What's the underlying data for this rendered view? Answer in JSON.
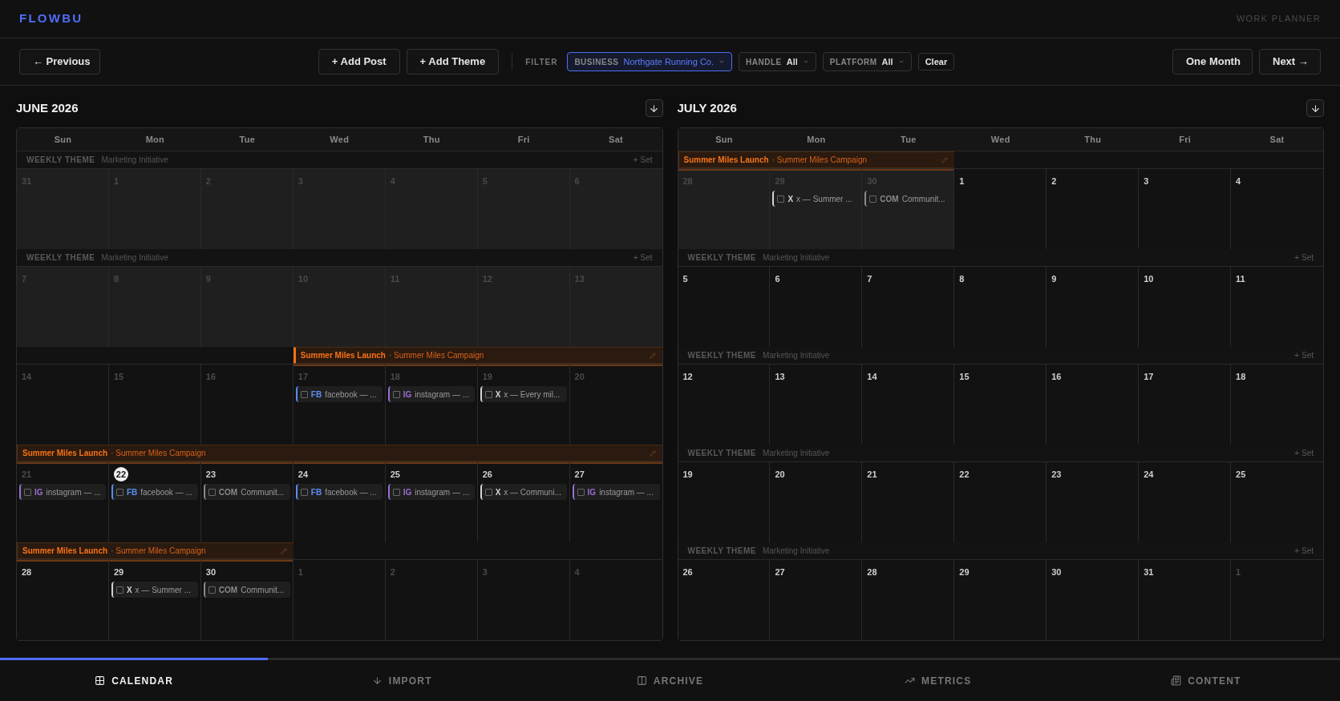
{
  "app": {
    "logo": "FLOWBU",
    "section": "WORK PLANNER"
  },
  "toolbar": {
    "previous": "← Previous",
    "add_post": "+ Add Post",
    "add_theme": "+ Add Theme",
    "filter_label": "FILTER",
    "filters": [
      {
        "label": "BUSINESS",
        "value": "Northgate Running Co.",
        "active": true
      },
      {
        "label": "HANDLE",
        "value": "All",
        "active": false
      },
      {
        "label": "PLATFORM",
        "value": "All",
        "active": false
      }
    ],
    "clear": "Clear",
    "range": "One Month",
    "next": "Next →"
  },
  "months": [
    {
      "title": "JUNE 2026",
      "weekdays": [
        "Sun",
        "Mon",
        "Tue",
        "Wed",
        "Thu",
        "Fri",
        "Sat"
      ],
      "weeks": [
        {
          "theme": {
            "kind": "placeholder",
            "title": "WEEKLY THEME",
            "subtitle": "Marketing Initiative",
            "action": "+ Set"
          },
          "days": [
            {
              "label": "31",
              "muted": true,
              "shaded": true,
              "today": false
            },
            {
              "label": "1",
              "muted": true,
              "shaded": true,
              "today": false
            },
            {
              "label": "2",
              "muted": true,
              "shaded": true,
              "today": false
            },
            {
              "label": "3",
              "muted": true,
              "shaded": true,
              "today": false
            },
            {
              "label": "4",
              "muted": true,
              "shaded": true,
              "today": false
            },
            {
              "label": "5",
              "muted": true,
              "shaded": true,
              "today": false
            },
            {
              "label": "6",
              "muted": true,
              "shaded": true,
              "today": false
            }
          ]
        },
        {
          "theme": {
            "kind": "placeholder",
            "title": "WEEKLY THEME",
            "subtitle": "Marketing Initiative",
            "action": "+ Set"
          },
          "days": [
            {
              "label": "7",
              "muted": true,
              "shaded": true,
              "today": false
            },
            {
              "label": "8",
              "muted": true,
              "shaded": true,
              "today": false
            },
            {
              "label": "9",
              "muted": true,
              "shaded": true,
              "today": false
            },
            {
              "label": "10",
              "muted": true,
              "shaded": true,
              "today": false
            },
            {
              "label": "11",
              "muted": true,
              "shaded": true,
              "today": false
            },
            {
              "label": "12",
              "muted": true,
              "shaded": true,
              "today": false
            },
            {
              "label": "13",
              "muted": true,
              "shaded": true,
              "today": false
            }
          ]
        },
        {
          "theme": {
            "kind": "campaign",
            "title": "Summer Miles Launch",
            "subtitle": "· Summer Miles Campaign",
            "starts": true
          },
          "days": [
            {
              "label": "14",
              "muted": true,
              "shaded": false,
              "today": false,
              "in_theme": false
            },
            {
              "label": "15",
              "muted": true,
              "shaded": false,
              "today": false,
              "in_theme": false
            },
            {
              "label": "16",
              "muted": true,
              "shaded": false,
              "today": false,
              "in_theme": false
            },
            {
              "label": "17",
              "muted": true,
              "shaded": false,
              "today": false,
              "in_theme": true,
              "posts": [
                {
                  "platform": "FB",
                  "text": "facebook — ...",
                  "color": "#5b8def",
                  "done": false
                }
              ]
            },
            {
              "label": "18",
              "muted": true,
              "shaded": false,
              "today": false,
              "in_theme": true,
              "posts": [
                {
                  "platform": "IG",
                  "text": "instagram — ...",
                  "color": "#9b6fd6",
                  "done": false
                }
              ]
            },
            {
              "label": "19",
              "muted": true,
              "shaded": false,
              "today": false,
              "in_theme": true,
              "posts": [
                {
                  "platform": "X",
                  "text": "x — Every mil...",
                  "color": "#d4d4d4",
                  "done": false
                }
              ]
            },
            {
              "label": "20",
              "muted": true,
              "shaded": false,
              "today": false,
              "in_theme": true
            }
          ]
        },
        {
          "theme": {
            "kind": "campaign",
            "title": "Summer Miles Launch",
            "subtitle": "· Summer Miles Campaign",
            "starts": false
          },
          "days": [
            {
              "label": "21",
              "muted": true,
              "shaded": false,
              "today": false,
              "in_theme": true,
              "posts": [
                {
                  "platform": "IG",
                  "text": "instagram — ...",
                  "color": "#9b6fd6",
                  "done": false
                }
              ]
            },
            {
              "label": "22",
              "muted": false,
              "shaded": false,
              "today": true,
              "in_theme": true,
              "posts": [
                {
                  "platform": "FB",
                  "text": "facebook — ...",
                  "color": "#5b8def",
                  "done": false
                }
              ]
            },
            {
              "label": "23",
              "muted": false,
              "shaded": false,
              "today": false,
              "in_theme": true,
              "posts": [
                {
                  "platform": "COM",
                  "text": "Communit...",
                  "color": "#8a8a8a",
                  "done": false
                }
              ]
            },
            {
              "label": "24",
              "muted": false,
              "shaded": false,
              "today": false,
              "in_theme": true,
              "posts": [
                {
                  "platform": "FB",
                  "text": "facebook — ...",
                  "color": "#5b8def",
                  "done": false
                }
              ]
            },
            {
              "label": "25",
              "muted": false,
              "shaded": false,
              "today": false,
              "in_theme": true,
              "posts": [
                {
                  "platform": "IG",
                  "text": "instagram — ...",
                  "color": "#9b6fd6",
                  "done": false
                }
              ]
            },
            {
              "label": "26",
              "muted": false,
              "shaded": false,
              "today": false,
              "in_theme": true,
              "posts": [
                {
                  "platform": "X",
                  "text": "x — Communi...",
                  "color": "#d4d4d4",
                  "done": false
                }
              ]
            },
            {
              "label": "27",
              "muted": false,
              "shaded": false,
              "today": false,
              "in_theme": true,
              "posts": [
                {
                  "platform": "IG",
                  "text": "instagram — ...",
                  "color": "#9b6fd6",
                  "done": false
                }
              ]
            }
          ]
        },
        {
          "theme": {
            "kind": "campaign",
            "title": "Summer Miles Launch",
            "subtitle": "· Summer Miles Campaign",
            "starts": false
          },
          "days": [
            {
              "label": "28",
              "muted": false,
              "shaded": false,
              "today": false,
              "in_theme": true
            },
            {
              "label": "29",
              "muted": false,
              "shaded": false,
              "today": false,
              "in_theme": true,
              "posts": [
                {
                  "platform": "X",
                  "text": "x — Summer ...",
                  "color": "#d4d4d4",
                  "done": false
                }
              ]
            },
            {
              "label": "30",
              "muted": false,
              "shaded": false,
              "today": false,
              "in_theme": true,
              "posts": [
                {
                  "platform": "COM",
                  "text": "Communit...",
                  "color": "#8a8a8a",
                  "done": false
                }
              ]
            },
            {
              "label": "1",
              "muted": true,
              "shaded": false,
              "today": false,
              "in_theme": false
            },
            {
              "label": "2",
              "muted": true,
              "shaded": false,
              "today": false,
              "in_theme": false
            },
            {
              "label": "3",
              "muted": true,
              "shaded": false,
              "today": false,
              "in_theme": false
            },
            {
              "label": "4",
              "muted": true,
              "shaded": false,
              "today": false,
              "in_theme": false
            }
          ]
        }
      ]
    },
    {
      "title": "JULY 2026",
      "weekdays": [
        "Sun",
        "Mon",
        "Tue",
        "Wed",
        "Thu",
        "Fri",
        "Sat"
      ],
      "weeks": [
        {
          "theme": {
            "kind": "campaign",
            "title": "Summer Miles Launch",
            "subtitle": "· Summer Miles Campaign",
            "starts": false
          },
          "days": [
            {
              "label": "28",
              "muted": true,
              "shaded": true,
              "today": false,
              "in_theme": true
            },
            {
              "label": "29",
              "muted": true,
              "shaded": true,
              "today": false,
              "in_theme": true,
              "posts": [
                {
                  "platform": "X",
                  "text": "x — Summer ...",
                  "color": "#d4d4d4",
                  "done": false
                }
              ]
            },
            {
              "label": "30",
              "muted": true,
              "shaded": true,
              "today": false,
              "in_theme": true,
              "posts": [
                {
                  "platform": "COM",
                  "text": "Communit...",
                  "color": "#8a8a8a",
                  "done": false
                }
              ]
            },
            {
              "label": "1",
              "muted": false,
              "shaded": false,
              "today": false,
              "in_theme": false
            },
            {
              "label": "2",
              "muted": false,
              "shaded": false,
              "today": false,
              "in_theme": false
            },
            {
              "label": "3",
              "muted": false,
              "shaded": false,
              "today": false,
              "in_theme": false
            },
            {
              "label": "4",
              "muted": false,
              "shaded": false,
              "today": false,
              "in_theme": false
            }
          ]
        },
        {
          "theme": {
            "kind": "placeholder",
            "title": "WEEKLY THEME",
            "subtitle": "Marketing Initiative",
            "action": "+ Set"
          },
          "days": [
            {
              "label": "5",
              "muted": false,
              "shaded": false,
              "today": false
            },
            {
              "label": "6",
              "muted": false,
              "shaded": false,
              "today": false
            },
            {
              "label": "7",
              "muted": false,
              "shaded": false,
              "today": false
            },
            {
              "label": "8",
              "muted": false,
              "shaded": false,
              "today": false
            },
            {
              "label": "9",
              "muted": false,
              "shaded": false,
              "today": false
            },
            {
              "label": "10",
              "muted": false,
              "shaded": false,
              "today": false
            },
            {
              "label": "11",
              "muted": false,
              "shaded": false,
              "today": false
            }
          ]
        },
        {
          "theme": {
            "kind": "placeholder",
            "title": "WEEKLY THEME",
            "subtitle": "Marketing Initiative",
            "action": "+ Set"
          },
          "days": [
            {
              "label": "12",
              "muted": false,
              "shaded": false,
              "today": false
            },
            {
              "label": "13",
              "muted": false,
              "shaded": false,
              "today": false
            },
            {
              "label": "14",
              "muted": false,
              "shaded": false,
              "today": false
            },
            {
              "label": "15",
              "muted": false,
              "shaded": false,
              "today": false
            },
            {
              "label": "16",
              "muted": false,
              "shaded": false,
              "today": false
            },
            {
              "label": "17",
              "muted": false,
              "shaded": false,
              "today": false
            },
            {
              "label": "18",
              "muted": false,
              "shaded": false,
              "today": false
            }
          ]
        },
        {
          "theme": {
            "kind": "placeholder",
            "title": "WEEKLY THEME",
            "subtitle": "Marketing Initiative",
            "action": "+ Set"
          },
          "days": [
            {
              "label": "19",
              "muted": false,
              "shaded": false,
              "today": false
            },
            {
              "label": "20",
              "muted": false,
              "shaded": false,
              "today": false
            },
            {
              "label": "21",
              "muted": false,
              "shaded": false,
              "today": false
            },
            {
              "label": "22",
              "muted": false,
              "shaded": false,
              "today": false
            },
            {
              "label": "23",
              "muted": false,
              "shaded": false,
              "today": false
            },
            {
              "label": "24",
              "muted": false,
              "shaded": false,
              "today": false
            },
            {
              "label": "25",
              "muted": false,
              "shaded": false,
              "today": false
            }
          ]
        },
        {
          "theme": {
            "kind": "placeholder",
            "title": "WEEKLY THEME",
            "subtitle": "Marketing Initiative",
            "action": "+ Set"
          },
          "days": [
            {
              "label": "26",
              "muted": false,
              "shaded": false,
              "today": false
            },
            {
              "label": "27",
              "muted": false,
              "shaded": false,
              "today": false
            },
            {
              "label": "28",
              "muted": false,
              "shaded": false,
              "today": false
            },
            {
              "label": "29",
              "muted": false,
              "shaded": false,
              "today": false
            },
            {
              "label": "30",
              "muted": false,
              "shaded": false,
              "today": false
            },
            {
              "label": "31",
              "muted": false,
              "shaded": false,
              "today": false
            },
            {
              "label": "1",
              "muted": true,
              "shaded": false,
              "today": false
            }
          ]
        }
      ]
    }
  ],
  "nav": [
    {
      "label": "CALENDAR",
      "selected": true
    },
    {
      "label": "IMPORT",
      "selected": false
    },
    {
      "label": "ARCHIVE",
      "selected": false
    },
    {
      "label": "METRICS",
      "selected": false
    },
    {
      "label": "CONTENT",
      "selected": false
    }
  ]
}
